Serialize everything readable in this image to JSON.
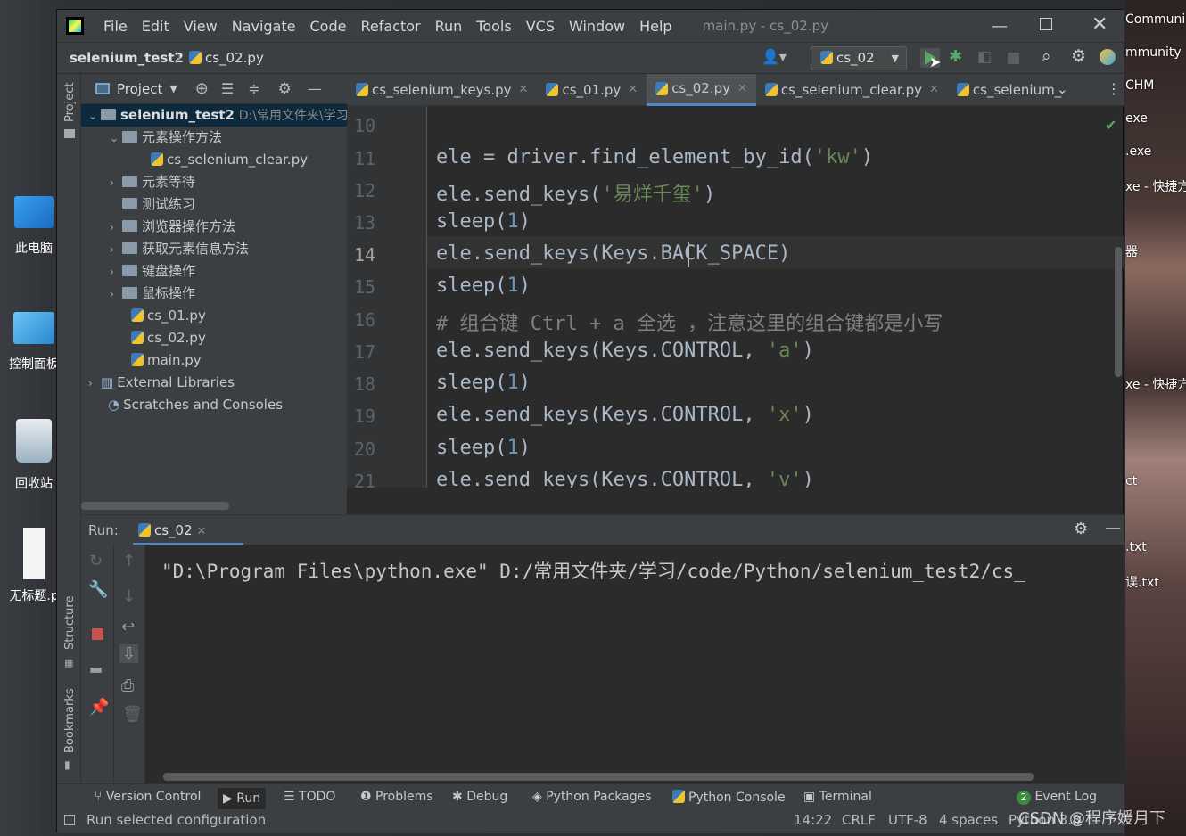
{
  "window_title": "main.py - cs_02.py",
  "menu": [
    {
      "label": "File"
    },
    {
      "label": "Edit"
    },
    {
      "label": "View"
    },
    {
      "label": "Navigate"
    },
    {
      "label": "Code"
    },
    {
      "label": "Refactor"
    },
    {
      "label": "Run"
    },
    {
      "label": "Tools"
    },
    {
      "label": "VCS"
    },
    {
      "label": "Window"
    },
    {
      "label": "Help"
    }
  ],
  "breadcrumb": {
    "project": "selenium_test2",
    "file": "cs_02.py"
  },
  "run_config": "cs_02",
  "project_panel": {
    "title": "Project",
    "root": {
      "name": "selenium_test2",
      "path": "D:\\常用文件夹\\学习"
    },
    "items": [
      {
        "label": "元素操作方法"
      },
      {
        "label": "cs_selenium_clear.py"
      },
      {
        "label": "元素等待"
      },
      {
        "label": "测试练习"
      },
      {
        "label": "浏览器操作方法"
      },
      {
        "label": "获取元素信息方法"
      },
      {
        "label": "键盘操作"
      },
      {
        "label": "鼠标操作"
      },
      {
        "label": "cs_01.py"
      },
      {
        "label": "cs_02.py"
      },
      {
        "label": "main.py"
      },
      {
        "label": "External Libraries"
      },
      {
        "label": "Scratches and Consoles"
      }
    ]
  },
  "side_tools": {
    "project": "Project",
    "structure": "Structure",
    "bookmarks": "Bookmarks"
  },
  "editor_tabs": [
    {
      "label": "cs_selenium_keys.py"
    },
    {
      "label": "cs_01.py"
    },
    {
      "label": "cs_02.py"
    },
    {
      "label": "cs_selenium_clear.py"
    },
    {
      "label": "cs_selenium_"
    }
  ],
  "code_lines": [
    {
      "num": "10"
    },
    {
      "num": "11"
    },
    {
      "num": "12"
    },
    {
      "num": "13"
    },
    {
      "num": "14"
    },
    {
      "num": "15"
    },
    {
      "num": "16"
    },
    {
      "num": "17"
    },
    {
      "num": "18"
    },
    {
      "num": "19"
    },
    {
      "num": "20"
    },
    {
      "num": "21"
    }
  ],
  "code": {
    "l11a": "ele = driver.find_element_by_id(",
    "l11s": "'kw'",
    "l11b": ")",
    "l12a": "ele.send_keys(",
    "l12s": "'易烊千玺'",
    "l12b": ")",
    "l13a": "sleep(",
    "l13n": "1",
    "l13b": ")",
    "l14a": "ele.send_keys(Keys.BACK_SPACE)",
    "l15a": "sleep(",
    "l15n": "1",
    "l15b": ")",
    "l16c": "# 组合键 Ctrl + a 全选 ，注意这里的组合键都是小写",
    "l17a": "ele.send_keys(Keys.CONTROL, ",
    "l17s": "'a'",
    "l17b": ")",
    "l18a": "sleep(",
    "l18n": "1",
    "l18b": ")",
    "l19a": "ele.send_keys(Keys.CONTROL, ",
    "l19s": "'x'",
    "l19b": ")",
    "l20a": "sleep(",
    "l20n": "1",
    "l20b": ")",
    "l21a": "ele.send_keys(Keys.CONTROL, ",
    "l21s": "'v'",
    "l21b": ")"
  },
  "run_panel": {
    "label": "Run:",
    "tab": "cs_02",
    "output": "\"D:\\Program Files\\python.exe\" D:/常用文件夹/学习/code/Python/selenium_test2/cs_"
  },
  "bottom_tools": [
    {
      "label": "Version Control"
    },
    {
      "label": "Run"
    },
    {
      "label": "TODO"
    },
    {
      "label": "Problems"
    },
    {
      "label": "Debug"
    },
    {
      "label": "Python Packages"
    },
    {
      "label": "Python Console"
    },
    {
      "label": "Terminal"
    },
    {
      "label": "Event Log"
    }
  ],
  "event_count": "2",
  "status": {
    "message": "Run selected configuration",
    "position": "14:22",
    "line_sep": "CRLF",
    "encoding": "UTF-8",
    "indent": "4 spaces",
    "interpreter": "Python 3.8"
  },
  "watermark": "CSDN @程序媛月下",
  "desktop_icons": [
    {
      "label": "此电脑"
    },
    {
      "label": "控制面板"
    },
    {
      "label": "回收站"
    },
    {
      "label": "无标题.p"
    }
  ],
  "right_labels": [
    {
      "label": "Communi"
    },
    {
      "label": "mmunity"
    },
    {
      "label": "CHM"
    },
    {
      "label": "exe"
    },
    {
      "label": ".exe"
    },
    {
      "label": "xe - 快捷方"
    },
    {
      "label": "器"
    },
    {
      "label": "xe - 快捷方"
    },
    {
      "label": "ct"
    },
    {
      "label": ".txt"
    },
    {
      "label": "误.txt"
    }
  ]
}
